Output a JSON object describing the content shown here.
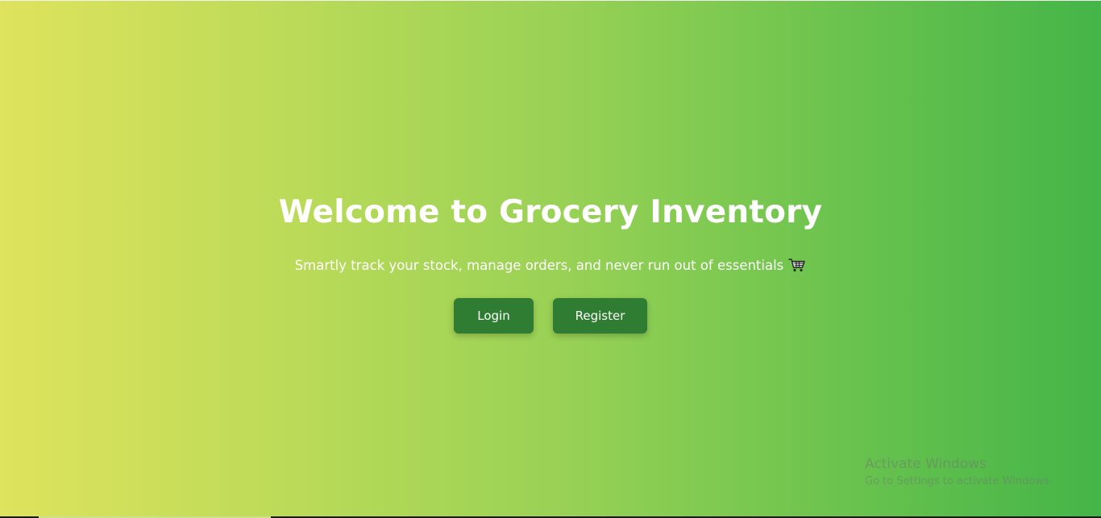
{
  "hero": {
    "title": "Welcome to Grocery Inventory",
    "subtitle": "Smartly track your stock, manage orders, and never run out of essentials",
    "subtitle_icon": "shopping-cart-icon"
  },
  "buttons": {
    "login_label": "Login",
    "register_label": "Register"
  },
  "watermark": {
    "title": "Activate Windows",
    "subtitle": "Go to Settings to activate Windows."
  },
  "colors": {
    "gradient_start": "#dfe35d",
    "gradient_end": "#44b548",
    "button_bg": "#2e7d32",
    "text": "#ffffff"
  }
}
